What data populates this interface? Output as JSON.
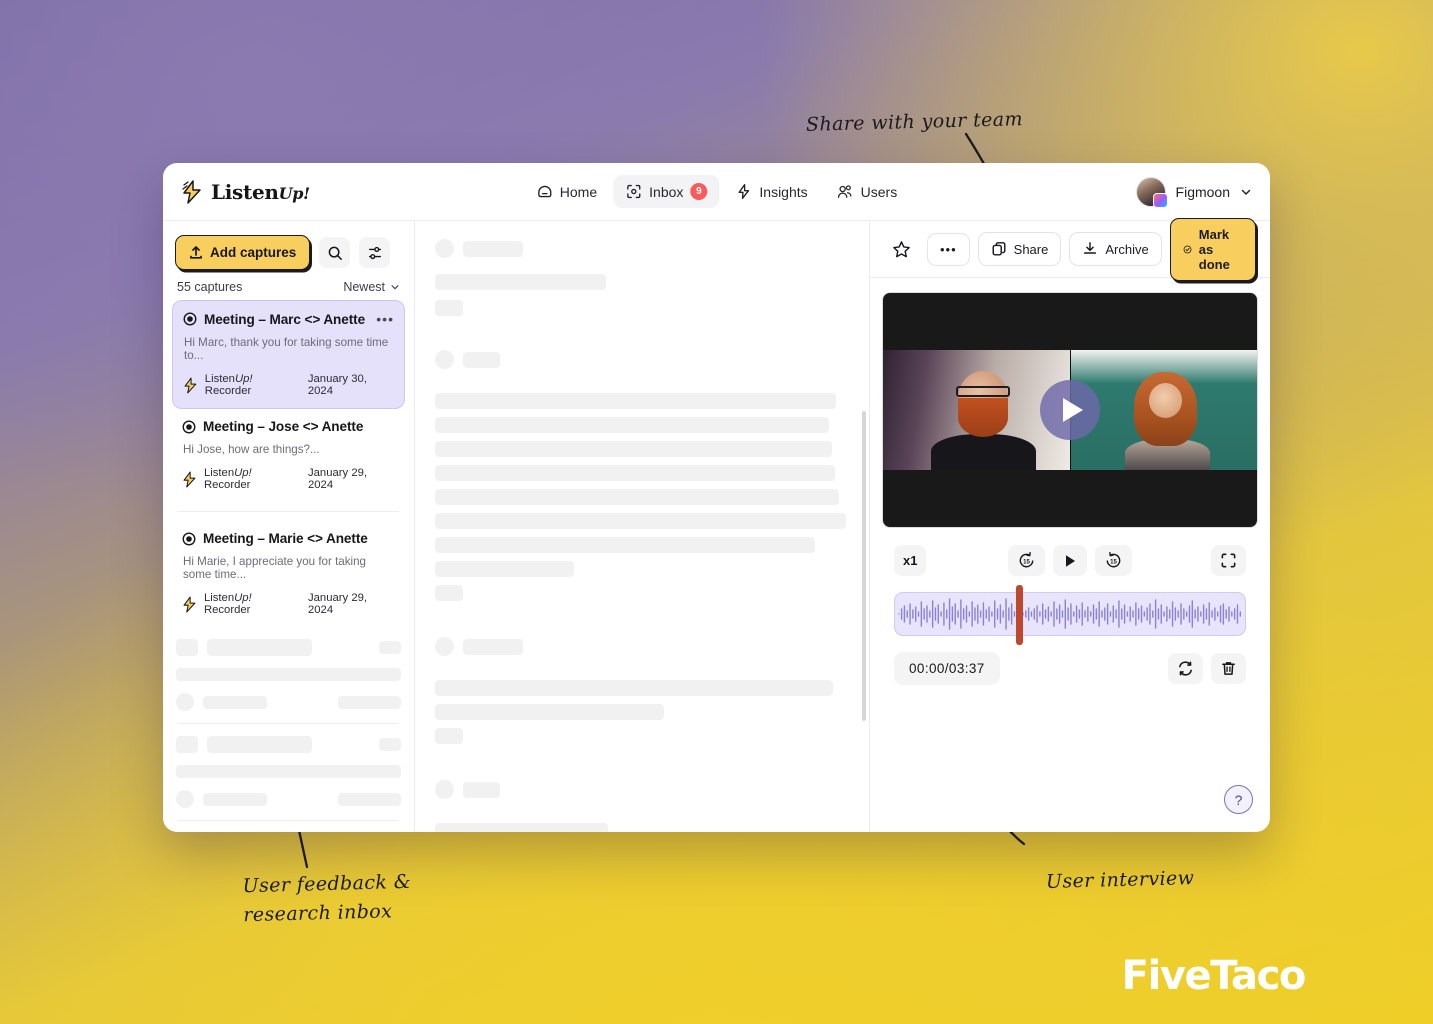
{
  "brand": {
    "name": "Listen",
    "suffix": "Up!",
    "logo_icon": "lightning-bolt-icon"
  },
  "nav": {
    "items": [
      {
        "label": "Home",
        "icon": "home-icon",
        "active": false,
        "badge": null
      },
      {
        "label": "Inbox",
        "icon": "scan-icon",
        "active": true,
        "badge": "9"
      },
      {
        "label": "Insights",
        "icon": "lightning-icon",
        "active": false,
        "badge": null
      },
      {
        "label": "Users",
        "icon": "users-icon",
        "active": false,
        "badge": null
      }
    ],
    "profile": {
      "name": "Figmoon",
      "chevron": "chevron-down-icon",
      "avatar": "user-avatar"
    }
  },
  "list": {
    "add_button": "Add captures",
    "search_icon": "search-icon",
    "filter_icon": "sliders-icon",
    "count": "55 captures",
    "sort": "Newest",
    "captures": [
      {
        "title": "Meeting – Marc <> Anette",
        "snippet": "Hi Marc, thank you for taking some time to...",
        "source_pre": "Listen",
        "source_em": "Up!",
        "source_post": " Recorder",
        "date": "January 30, 2024",
        "selected": true
      },
      {
        "title": "Meeting – Jose <> Anette",
        "snippet": "Hi Jose, how are things?...",
        "source_pre": "Listen",
        "source_em": "Up!",
        "source_post": " Recorder",
        "date": "January 29, 2024",
        "selected": false
      },
      {
        "title": "Meeting – Marie <> Anette",
        "snippet": "Hi Marie, I appreciate you for taking some time...",
        "source_pre": "Listen",
        "source_em": "Up!",
        "source_post": " Recorder",
        "date": "January 29, 2024",
        "selected": false
      }
    ]
  },
  "detail": {
    "actions": {
      "star": "star-icon",
      "more": "•••",
      "share": "Share",
      "archive": "Archive",
      "mark_done": "Mark as done"
    },
    "player": {
      "play_icon": "play-icon",
      "speed": "x1",
      "rewind": "15",
      "forward": "15",
      "fullscreen_icon": "fullscreen-icon",
      "time": "00:00/03:37",
      "reprocess_icon": "refresh-icon",
      "delete_icon": "trash-icon"
    },
    "help": "?"
  },
  "annotations": {
    "share": "Share with your team",
    "inbox": "User feedback &\nresearch inbox",
    "interview": "User interview"
  },
  "watermark": "FiveTaco",
  "colors": {
    "accent_yellow": "#f8cf5e",
    "selected_purple": "#e5e1fb",
    "badge_red": "#fb5a5a",
    "playhead_red": "#c0472e",
    "wave_purple": "#8a82d8"
  }
}
